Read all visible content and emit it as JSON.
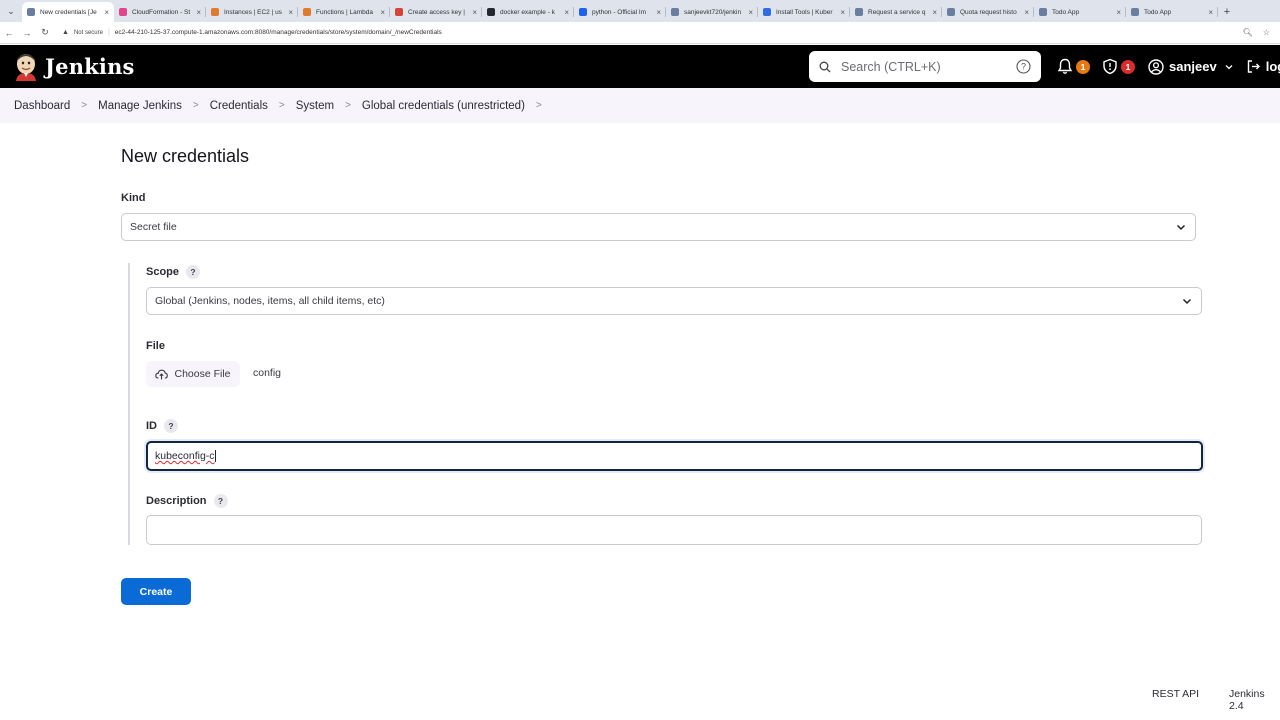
{
  "browser": {
    "tabs": [
      {
        "title": "New credentials [Je",
        "active": true,
        "color": "#6a7fa0"
      },
      {
        "title": "CloudFormation - St",
        "active": false,
        "color": "#e0448a"
      },
      {
        "title": "Instances | EC2 | us",
        "active": false,
        "color": "#e07b2e"
      },
      {
        "title": "Functions | Lambda",
        "active": false,
        "color": "#e07b2e"
      },
      {
        "title": "Create access key |",
        "active": false,
        "color": "#d5433a"
      },
      {
        "title": "docker example - k",
        "active": false,
        "color": "#24292f"
      },
      {
        "title": "python - Official Im",
        "active": false,
        "color": "#1d63ed"
      },
      {
        "title": "sanjeevkt720/jenkin",
        "active": false,
        "color": "#6a7fa0"
      },
      {
        "title": "Install Tools | Kuber",
        "active": false,
        "color": "#326ce5"
      },
      {
        "title": "Request a service q",
        "active": false,
        "color": "#6a7fa0"
      },
      {
        "title": "Quota request histo",
        "active": false,
        "color": "#6a7fa0"
      },
      {
        "title": "Todo App",
        "active": false,
        "color": "#6a7fa0"
      },
      {
        "title": "Todo App",
        "active": false,
        "color": "#6a7fa0"
      }
    ],
    "not_secure": "Not secure",
    "url": "ec2-44-210-125-37.compute-1.amazonaws.com:8080/manage/credentials/store/system/domain/_/newCredentials"
  },
  "header": {
    "logo_text": "Jenkins",
    "search_placeholder": "Search (CTRL+K)",
    "notifications_count": "1",
    "security_count": "1",
    "user_name": "sanjeev",
    "logout_label": "log"
  },
  "breadcrumb": [
    "Dashboard",
    "Manage Jenkins",
    "Credentials",
    "System",
    "Global credentials (unrestricted)"
  ],
  "form": {
    "title": "New credentials",
    "kind_label": "Kind",
    "kind_value": "Secret file",
    "scope_label": "Scope",
    "scope_value": "Global (Jenkins, nodes, items, all child items, etc)",
    "file_label": "File",
    "choose_file_label": "Choose File",
    "file_name": "config",
    "id_label": "ID",
    "id_value": "kubeconfig-c",
    "description_label": "Description",
    "description_value": "",
    "create_label": "Create"
  },
  "footer": {
    "rest_api": "REST API",
    "version": "Jenkins 2.4"
  },
  "colors": {
    "header_bg": "#000000",
    "breadcrumb_bg": "#f7f4fb",
    "primary_button": "#0b6bd6",
    "badge_orange": "#e7790f",
    "badge_red": "#d72d2d"
  }
}
